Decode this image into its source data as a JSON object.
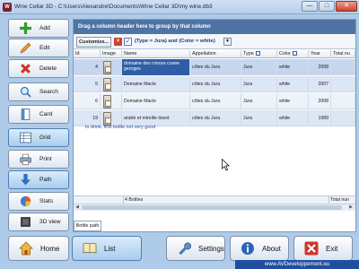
{
  "window": {
    "title": "Wine Cellar 3D - C:\\Users\\Alexandre\\Documents\\Wine Cellar 3D\\my wine.db3",
    "minimize_glyph": "—",
    "maximize_glyph": "□",
    "close_glyph": "✕"
  },
  "sidebar": {
    "items": [
      {
        "label": "Add",
        "icon": "add-icon"
      },
      {
        "label": "Edit",
        "icon": "pencil-icon"
      },
      {
        "label": "Delete",
        "icon": "delete-icon"
      },
      {
        "label": "Search",
        "icon": "magnifier-icon"
      },
      {
        "label": "Card",
        "icon": "card-icon"
      },
      {
        "label": "Grid",
        "icon": "grid-icon"
      },
      {
        "label": "Print",
        "icon": "printer-icon"
      },
      {
        "label": "Path",
        "icon": "path-arrow-icon"
      },
      {
        "label": "Stats",
        "icon": "pie-chart-icon"
      },
      {
        "label": "3D view",
        "icon": "cube-icon"
      }
    ]
  },
  "grid": {
    "group_hint": "Drag a column header here to group by that column",
    "customize_label": "Customize...",
    "filter_expression": "(Type = Jura) and (Color = white)",
    "columns": [
      "Id",
      "Image",
      "Name",
      "Appellation",
      "Type",
      "Color",
      "Year",
      "Total nu"
    ],
    "rows": [
      {
        "id": "4",
        "name": "domaine des ronces cuvee georges",
        "appellation": "côtes du Jura",
        "type": "Jura",
        "color": "white",
        "year": "2008"
      },
      {
        "id": "5",
        "name": "Domaine Macle",
        "appellation": "côtes du Jura",
        "type": "Jura",
        "color": "white",
        "year": "2007"
      },
      {
        "id": "6",
        "name": "Domaine Macle",
        "appellation": "côtes du Jura",
        "type": "Jura",
        "color": "white",
        "year": "2008"
      },
      {
        "id": "19",
        "name": "andré et mireille tissot",
        "appellation": "côtes du Jura",
        "type": "Jura",
        "color": "white",
        "year": "1989"
      }
    ],
    "comment": "to drink, first bottle not very good",
    "footer_count": "4 Bottles",
    "footer_total": "Total nun",
    "tab_label": "Bottle path"
  },
  "bottom": {
    "home_label": "Home",
    "list_label": "List",
    "settings_label": "Settings",
    "about_label": "About",
    "exit_label": "Exit"
  },
  "watermark": "www.AVDeveloppement.eu",
  "colors": {
    "background": "#aecbe9",
    "selected_row": "#c6d6ef",
    "group_bar": "#4f74a4",
    "comment_text": "#2552a8"
  }
}
